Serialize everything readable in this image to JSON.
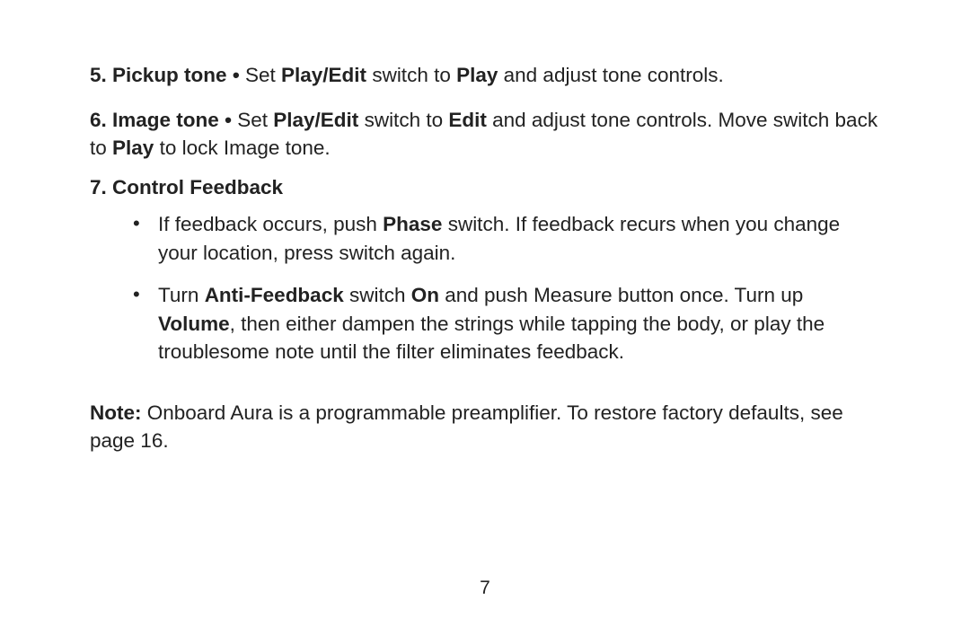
{
  "pageNumber": "7",
  "item5": {
    "number": "5.",
    "title": "Pickup tone",
    "bullet": "•",
    "t1": "Set ",
    "b1": "Play/Edit",
    "t2": " switch to ",
    "b2": "Play",
    "t3": " and adjust tone controls."
  },
  "item6": {
    "number": "6.",
    "title": "Image tone",
    "bullet": "•",
    "t1": "Set ",
    "b1": "Play/Edit",
    "t2": " switch to ",
    "b2": "Edit",
    "t3": " and adjust tone controls. Move switch back to ",
    "b3": "Play",
    "t4": " to lock Image tone."
  },
  "item7": {
    "number": "7.",
    "title": "Control Feedback",
    "bullets": [
      {
        "t1": "If feedback occurs, push ",
        "b1": "Phase",
        "t2": " switch. If feedback recurs when you change your location, press switch again.",
        "b2": "",
        "t3": "",
        "b3": "",
        "t4": ""
      },
      {
        "t1": "Turn ",
        "b1": "Anti-Feedback",
        "t2": " switch ",
        "b2": "On",
        "t3": " and push Measure button once. Turn up ",
        "b3": "Volume",
        "t4": ", then either dampen the strings while tapping the body, or play the troublesome note until the filter eliminates feedback."
      }
    ]
  },
  "note": {
    "label": "Note:",
    "text": " Onboard Aura is a programmable preamplifier. To restore factory defaults, see page 16."
  }
}
